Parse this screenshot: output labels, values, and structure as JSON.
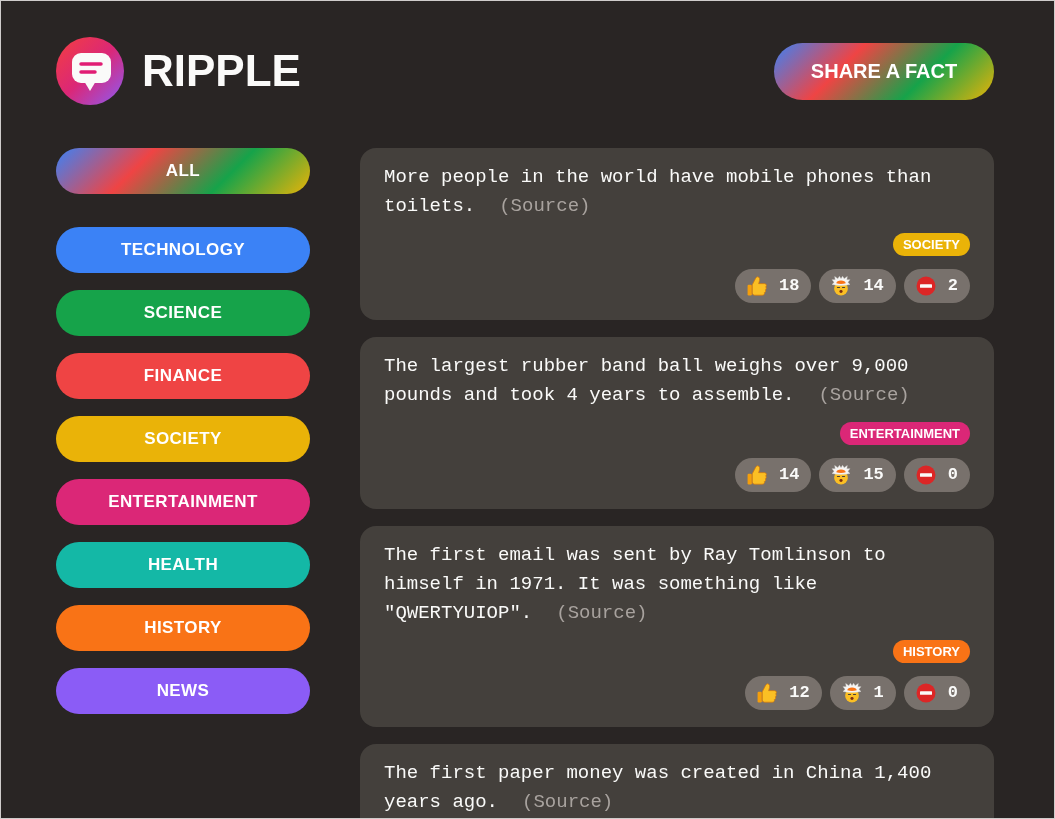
{
  "header": {
    "title": "RIPPLE",
    "share_button": "SHARE A FACT"
  },
  "categories": [
    {
      "label": "ALL",
      "kind": "all"
    },
    {
      "label": "TECHNOLOGY",
      "kind": "category",
      "color": "#3b82f6"
    },
    {
      "label": "SCIENCE",
      "kind": "category",
      "color": "#16a34a"
    },
    {
      "label": "FINANCE",
      "kind": "category",
      "color": "#ef4444"
    },
    {
      "label": "SOCIETY",
      "kind": "category",
      "color": "#eab308"
    },
    {
      "label": "ENTERTAINMENT",
      "kind": "category",
      "color": "#db2777"
    },
    {
      "label": "HEALTH",
      "kind": "category",
      "color": "#14b8a6"
    },
    {
      "label": "HISTORY",
      "kind": "category",
      "color": "#f97316"
    },
    {
      "label": "NEWS",
      "kind": "category",
      "color": "#8b5cf6"
    }
  ],
  "facts": [
    {
      "text": "More people in the world have mobile phones than toilets.",
      "source": "(Source)",
      "category": {
        "label": "SOCIETY",
        "color": "#eab308"
      },
      "votes": [
        {
          "kind": "like",
          "count": "18"
        },
        {
          "kind": "mindblown",
          "count": "14"
        },
        {
          "kind": "false",
          "count": "2"
        }
      ]
    },
    {
      "text": "The largest rubber band ball weighs over 9,000 pounds and took 4 years to assemble.",
      "source": "(Source)",
      "category": {
        "label": "ENTERTAINMENT",
        "color": "#db2777"
      },
      "votes": [
        {
          "kind": "like",
          "count": "14"
        },
        {
          "kind": "mindblown",
          "count": "15"
        },
        {
          "kind": "false",
          "count": "0"
        }
      ]
    },
    {
      "text": "The first email was sent by Ray Tomlinson to himself in 1971. It was something like \"QWERTYUIOP\".",
      "source": "(Source)",
      "category": {
        "label": "HISTORY",
        "color": "#f97316"
      },
      "votes": [
        {
          "kind": "like",
          "count": "12"
        },
        {
          "kind": "mindblown",
          "count": "1"
        },
        {
          "kind": "false",
          "count": "0"
        }
      ]
    },
    {
      "text": "The first paper money was created in China 1,400 years ago.",
      "source": "(Source)"
    }
  ]
}
